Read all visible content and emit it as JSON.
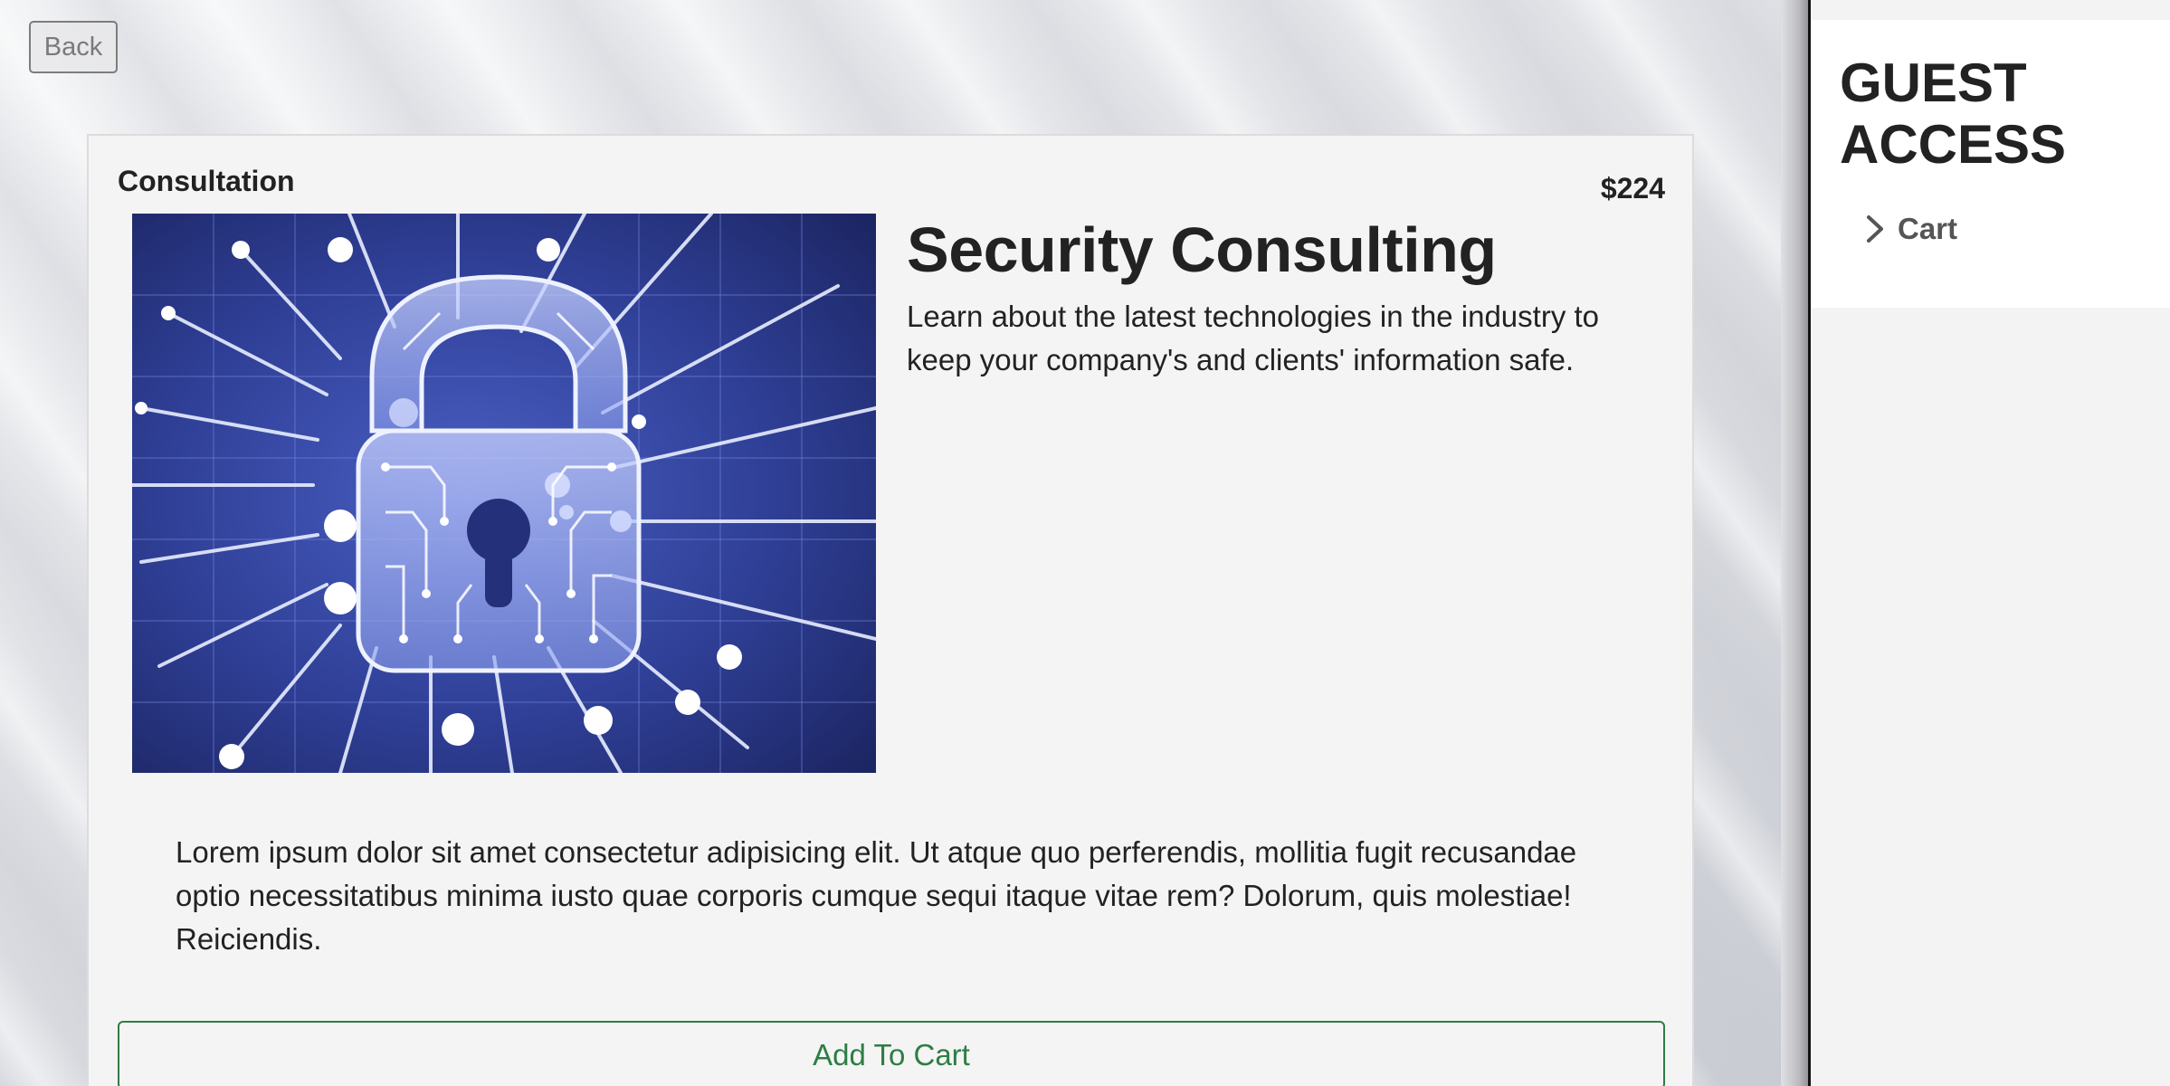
{
  "header": {
    "back_label": "Back"
  },
  "product": {
    "category": "Consultation",
    "price": "$224",
    "title": "Security Consulting",
    "summary": "Learn about the latest technologies in the industry to keep your company's and clients' information safe.",
    "description": "Lorem ipsum dolor sit amet consectetur adipisicing elit. Ut atque quo perferendis, mollitia fugit recusandae optio necessitatibus minima iusto quae corporis cumque sequi itaque vitae rem? Dolorum, quis molestiae! Reiciendis.",
    "image_icon": "circuit-padlock-image",
    "add_to_cart_label": "Add To Cart"
  },
  "sidebar": {
    "title": "GUEST ACCESS",
    "items": [
      {
        "label": "Cart",
        "icon": "chevron-right-icon"
      }
    ]
  },
  "colors": {
    "accent_green": "#2e7d45",
    "image_blue": "#2e3b8a"
  }
}
